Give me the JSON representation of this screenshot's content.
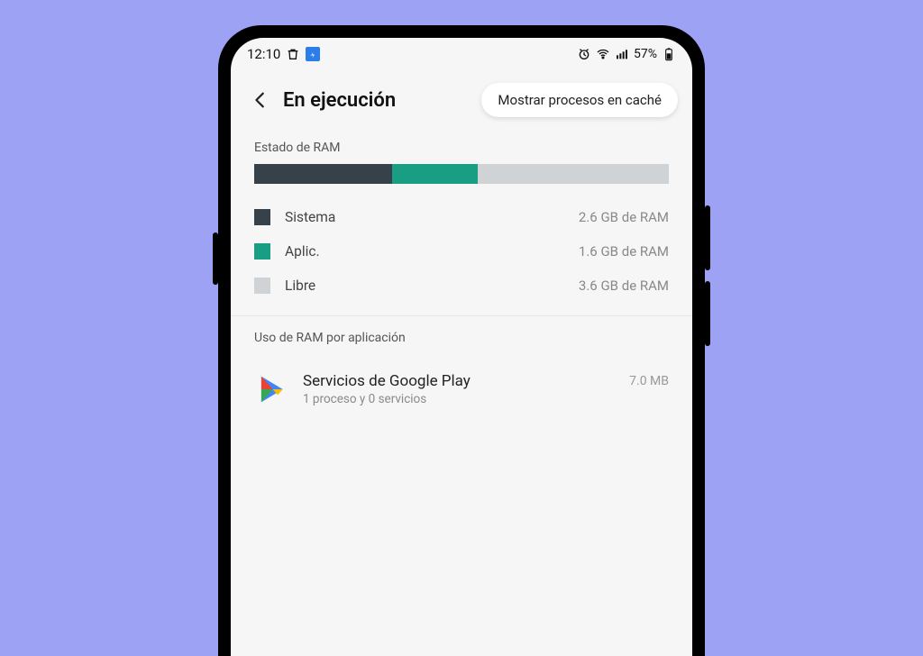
{
  "status": {
    "time": "12:10",
    "battery_pct": "57%"
  },
  "header": {
    "title": "En ejecución",
    "chip": "Mostrar procesos en caché"
  },
  "ram": {
    "section_label": "Estado de RAM",
    "segments": [
      {
        "key": "system",
        "label": "Sistema",
        "value": "2.6 GB de RAM",
        "color": "#37414a",
        "gb": 2.6
      },
      {
        "key": "apps",
        "label": "Aplic.",
        "value": "1.6 GB de RAM",
        "color": "#199e84",
        "gb": 1.6
      },
      {
        "key": "free",
        "label": "Libre",
        "value": "3.6 GB de RAM",
        "color": "#cfd3d6",
        "gb": 3.6
      }
    ],
    "total_gb": 7.8
  },
  "apps_section_label": "Uso de RAM por aplicación",
  "apps": [
    {
      "name": "Servicios de Google Play",
      "sub": "1 proceso y 0 servicios",
      "size": "7.0 MB"
    }
  ],
  "chart_data": {
    "type": "bar",
    "title": "Estado de RAM",
    "categories": [
      "Sistema",
      "Aplic.",
      "Libre"
    ],
    "values": [
      2.6,
      1.6,
      3.6
    ],
    "ylabel": "GB de RAM",
    "ylim": [
      0,
      7.8
    ],
    "colors": [
      "#37414a",
      "#199e84",
      "#cfd3d6"
    ]
  }
}
